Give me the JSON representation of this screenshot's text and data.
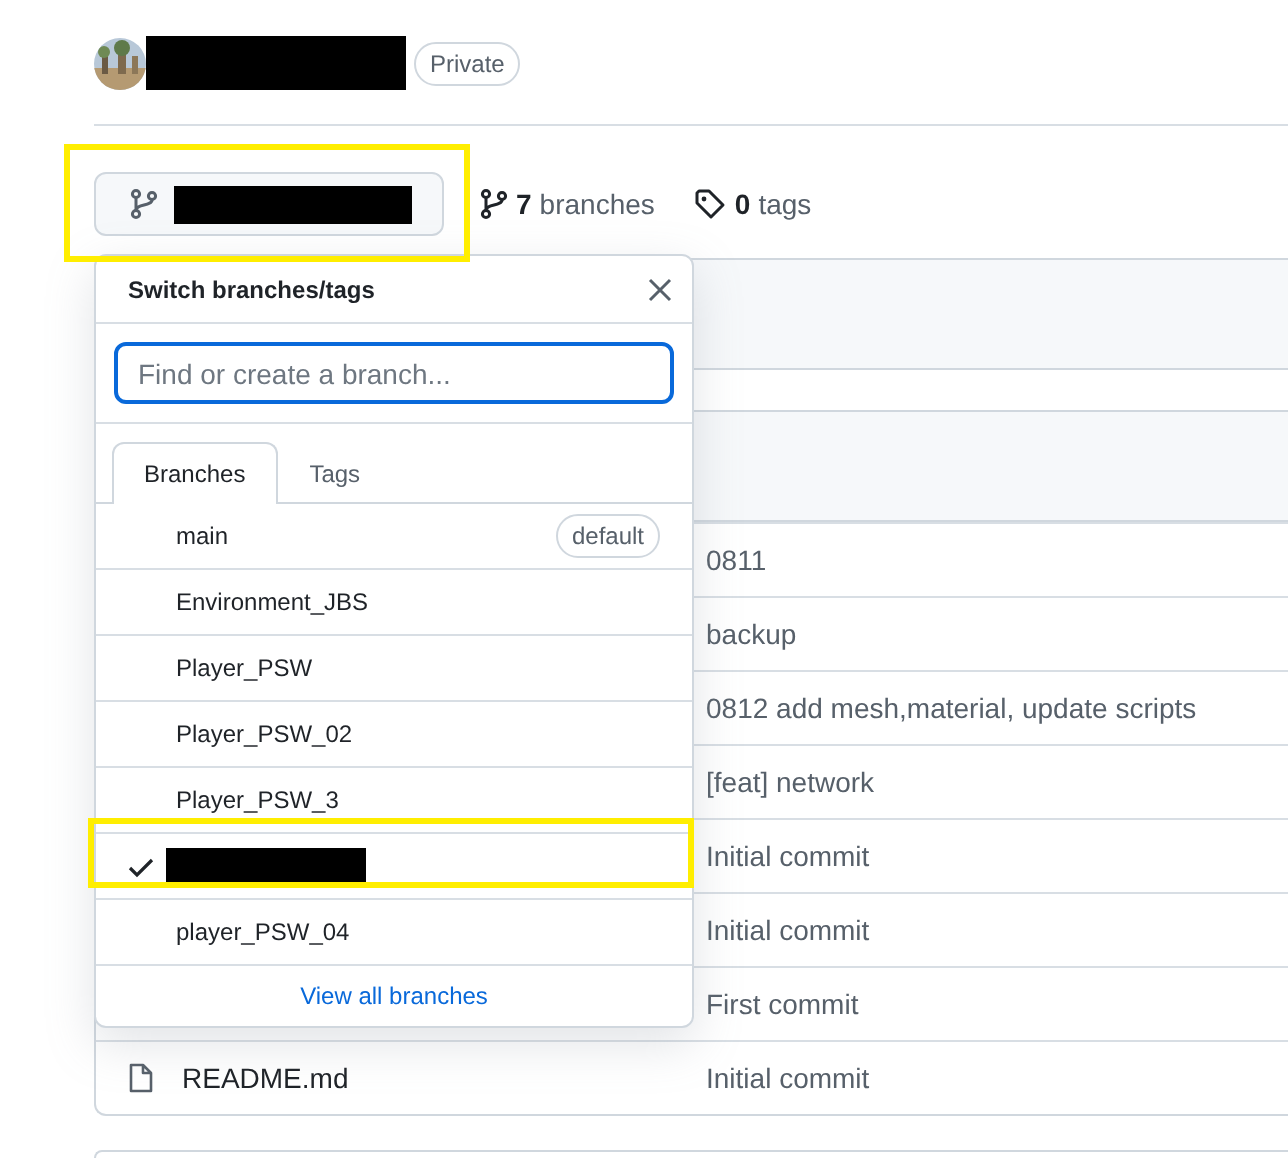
{
  "repo": {
    "visibility": "Private"
  },
  "counts": [
    {
      "kind": "branches",
      "number": "7",
      "label": "branches"
    },
    {
      "kind": "tags",
      "number": "0",
      "label": "tags"
    }
  ],
  "branch_menu": {
    "title": "Switch branches/tags",
    "search": {
      "placeholder": "Find or create a branch..."
    },
    "tabs": [
      {
        "label": "Branches",
        "selected": true
      },
      {
        "label": "Tags",
        "selected": false
      }
    ],
    "branches": [
      {
        "name": "main",
        "badge": "default",
        "selected": false,
        "redacted": false
      },
      {
        "name": "Environment_JBS",
        "selected": false,
        "redacted": false
      },
      {
        "name": "Player_PSW",
        "selected": false,
        "redacted": false
      },
      {
        "name": "Player_PSW_02",
        "selected": false,
        "redacted": false
      },
      {
        "name": "Player_PSW_3",
        "selected": false,
        "redacted": false
      },
      {
        "selected": true,
        "redacted": true
      },
      {
        "name": "player_PSW_04",
        "selected": false,
        "redacted": false
      }
    ],
    "footer_link": "View all branches"
  },
  "files": [
    {
      "message": "0811"
    },
    {
      "message": "backup"
    },
    {
      "message": "0812 add mesh,material, update scripts"
    },
    {
      "message": "[feat] network"
    },
    {
      "message": "Initial commit"
    },
    {
      "message": "Initial commit"
    },
    {
      "message": "First commit"
    },
    {
      "kind": "file",
      "name": "README.md",
      "message": "Initial commit"
    }
  ]
}
